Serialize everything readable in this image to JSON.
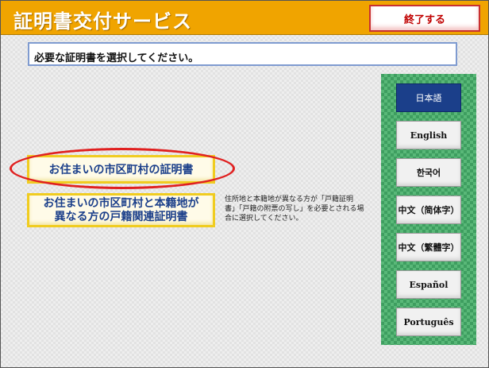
{
  "header": {
    "title": "証明書交付サービス",
    "end_button_label": "終了する"
  },
  "instruction": "必要な証明書を選択してください。",
  "certificates": {
    "resident_label": "お住まいの市区町村の証明書",
    "family_register_line1": "お住まいの市区町村と本籍地が",
    "family_register_line2": "異なる方の戸籍関連証明書",
    "note": "住所地と本籍地が異なる方が「戸籍証明書」「戸籍の附票の写し」を必要とされる場合に選択してください。"
  },
  "languages": [
    {
      "label": "日本語",
      "active": true
    },
    {
      "label": "English",
      "active": false
    },
    {
      "label": "한국어",
      "active": false
    },
    {
      "label": "中文（简体字）",
      "active": false
    },
    {
      "label": "中文（繁體字）",
      "active": false
    },
    {
      "label": "Español",
      "active": false
    },
    {
      "label": "Português",
      "active": false
    }
  ],
  "colors": {
    "header_bg": "#f0a400",
    "highlight_ring": "#e02020",
    "language_panel": "#3e9e60",
    "active_language": "#1b3f8a"
  }
}
